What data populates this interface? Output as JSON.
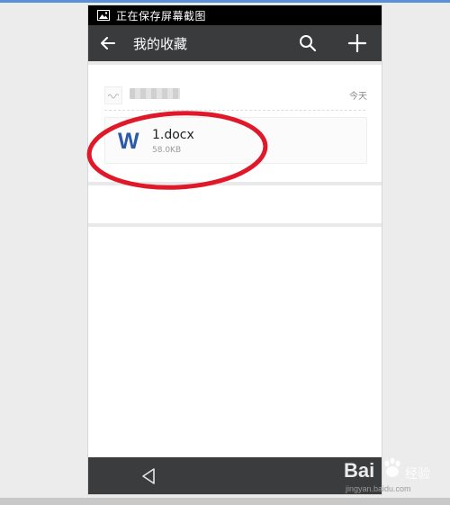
{
  "status_bar": {
    "text": "正在保存屏幕截图",
    "icon": "image-icon"
  },
  "app_bar": {
    "title": "我的收藏",
    "back_icon": "arrow-left-icon",
    "search_icon": "search-icon",
    "add_icon": "plus-icon"
  },
  "favorite_item": {
    "sender_avatar_icon": "avatar-icon",
    "time": "今天",
    "file": {
      "name": "1.docx",
      "size": "58.0KB",
      "icon_letter": "W",
      "icon": "word-icon"
    }
  },
  "nav_bar": {
    "back_icon": "triangle-back-icon"
  },
  "watermark": {
    "brand": "Bai",
    "suffix": "经验",
    "url": "jingyan.baidu.com"
  },
  "colors": {
    "app_bar": "#3a3b3d",
    "status_bar": "#000000",
    "word_blue": "#2b5aa8",
    "highlight_red": "#e0192a",
    "accent": "#5b8fd8"
  }
}
